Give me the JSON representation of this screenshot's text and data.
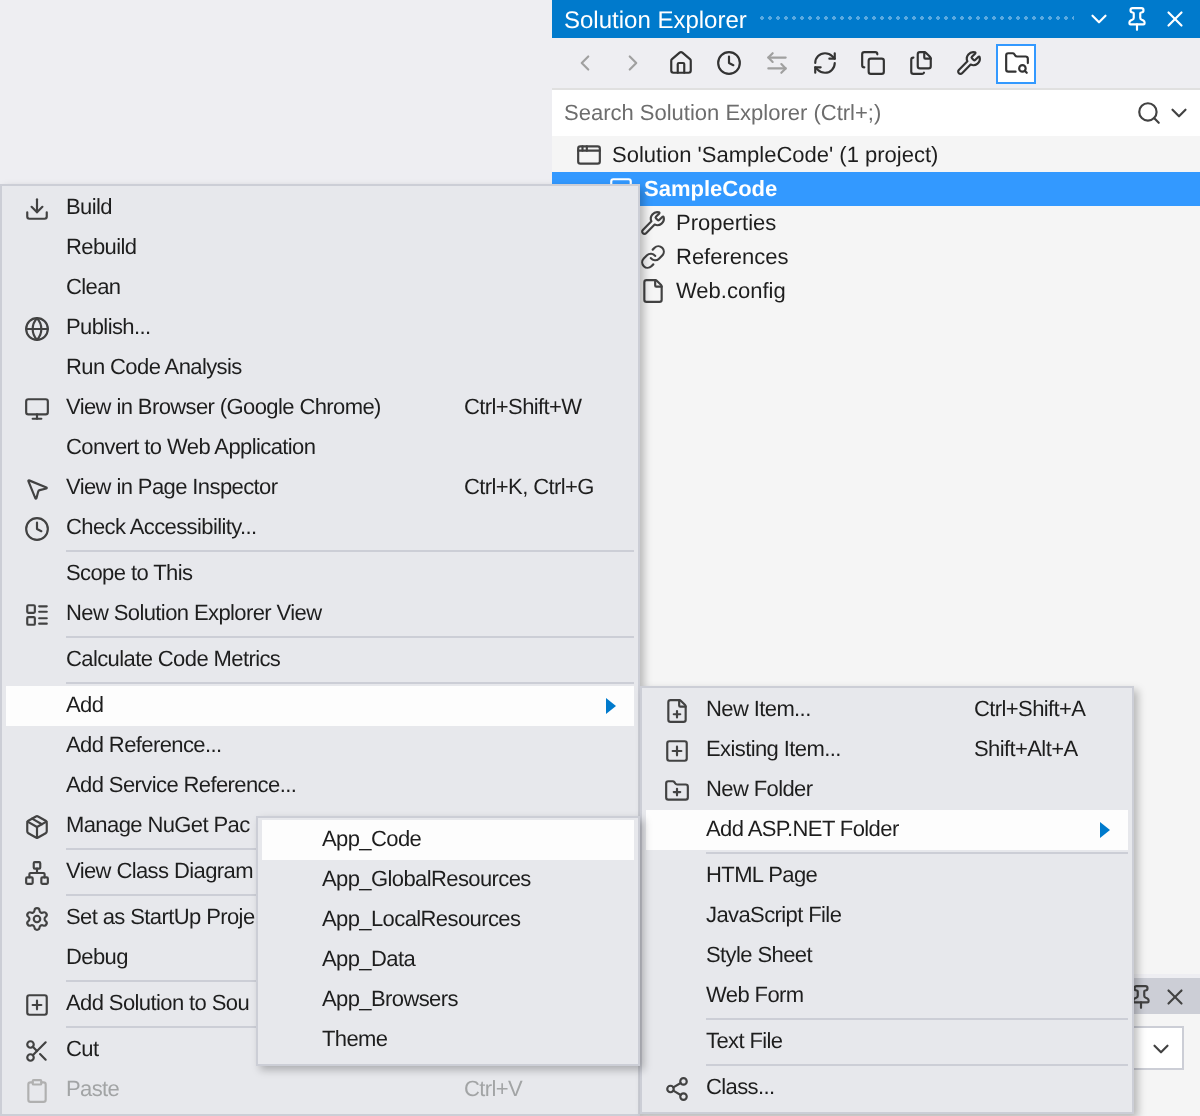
{
  "solution_explorer": {
    "title": "Solution Explorer",
    "search": {
      "placeholder": "Search Solution Explorer (Ctrl+;)"
    },
    "tree": [
      {
        "label": "Solution 'SampleCode' (1 project)",
        "selected": false,
        "children": [
          {
            "label": "SampleCode",
            "selected": true,
            "children": [
              {
                "label": "Properties",
                "selected": false
              },
              {
                "label": "References",
                "selected": false
              },
              {
                "label": "Web.config",
                "selected": false
              }
            ]
          }
        ]
      }
    ]
  },
  "context_menu": {
    "items": [
      {
        "kind": "item",
        "label": "Build",
        "selected": false
      },
      {
        "kind": "item",
        "label": "Rebuild",
        "selected": false
      },
      {
        "kind": "item",
        "label": "Clean",
        "selected": false
      },
      {
        "kind": "item",
        "label": "Publish...",
        "selected": false
      },
      {
        "kind": "item",
        "label": "Run Code Analysis",
        "selected": false
      },
      {
        "kind": "item",
        "label": "View in Browser (Google Chrome)",
        "shortcut": "Ctrl+Shift+W",
        "selected": false
      },
      {
        "kind": "item",
        "label": "Convert to Web Application",
        "selected": false
      },
      {
        "kind": "item",
        "label": "View in Page Inspector",
        "shortcut": "Ctrl+K, Ctrl+G",
        "selected": false
      },
      {
        "kind": "item",
        "label": "Check Accessibility...",
        "selected": false
      },
      {
        "kind": "separator"
      },
      {
        "kind": "item",
        "label": "Scope to This",
        "selected": false
      },
      {
        "kind": "item",
        "label": "New Solution Explorer View",
        "selected": false
      },
      {
        "kind": "separator"
      },
      {
        "kind": "item",
        "label": "Calculate Code Metrics",
        "selected": false
      },
      {
        "kind": "separator"
      },
      {
        "kind": "item",
        "label": "Add",
        "selected": true,
        "submenu": true
      },
      {
        "kind": "item",
        "label": "Add Reference...",
        "selected": false
      },
      {
        "kind": "item",
        "label": "Add Service Reference...",
        "selected": false
      },
      {
        "kind": "item",
        "label": "Manage NuGet Pac",
        "selected": false
      },
      {
        "kind": "separator"
      },
      {
        "kind": "item",
        "label": "View Class Diagram",
        "selected": false
      },
      {
        "kind": "separator"
      },
      {
        "kind": "item",
        "label": "Set as StartUp Proje",
        "selected": false
      },
      {
        "kind": "item",
        "label": "Debug",
        "selected": false
      },
      {
        "kind": "separator"
      },
      {
        "kind": "item",
        "label": "Add Solution to Sou",
        "selected": false
      },
      {
        "kind": "separator"
      },
      {
        "kind": "item",
        "label": "Cut",
        "selected": false
      },
      {
        "kind": "item",
        "label": "Paste",
        "shortcut": "Ctrl+V",
        "selected": false,
        "disabled": true
      }
    ]
  },
  "add_submenu": {
    "items": [
      {
        "kind": "item",
        "label": "New Item...",
        "shortcut": "Ctrl+Shift+A",
        "selected": false
      },
      {
        "kind": "item",
        "label": "Existing Item...",
        "shortcut": "Shift+Alt+A",
        "selected": false
      },
      {
        "kind": "item",
        "label": "New Folder",
        "selected": false
      },
      {
        "kind": "item",
        "label": "Add ASP.NET Folder",
        "selected": true,
        "submenu": true
      },
      {
        "kind": "separator"
      },
      {
        "kind": "item",
        "label": "HTML Page",
        "selected": false
      },
      {
        "kind": "item",
        "label": "JavaScript File",
        "selected": false
      },
      {
        "kind": "item",
        "label": "Style Sheet",
        "selected": false
      },
      {
        "kind": "item",
        "label": "Web Form",
        "selected": false
      },
      {
        "kind": "separator"
      },
      {
        "kind": "item",
        "label": "Text File",
        "selected": false
      },
      {
        "kind": "separator"
      },
      {
        "kind": "item",
        "label": "Class...",
        "selected": false
      }
    ]
  },
  "asp_net_folder_submenu": {
    "items": [
      {
        "kind": "item",
        "label": "App_Code",
        "selected": true
      },
      {
        "kind": "item",
        "label": "App_GlobalResources",
        "selected": false
      },
      {
        "kind": "item",
        "label": "App_LocalResources",
        "selected": false
      },
      {
        "kind": "item",
        "label": "App_Data",
        "selected": false
      },
      {
        "kind": "item",
        "label": "App_Browsers",
        "selected": false
      },
      {
        "kind": "item",
        "label": "Theme",
        "selected": false
      }
    ]
  }
}
